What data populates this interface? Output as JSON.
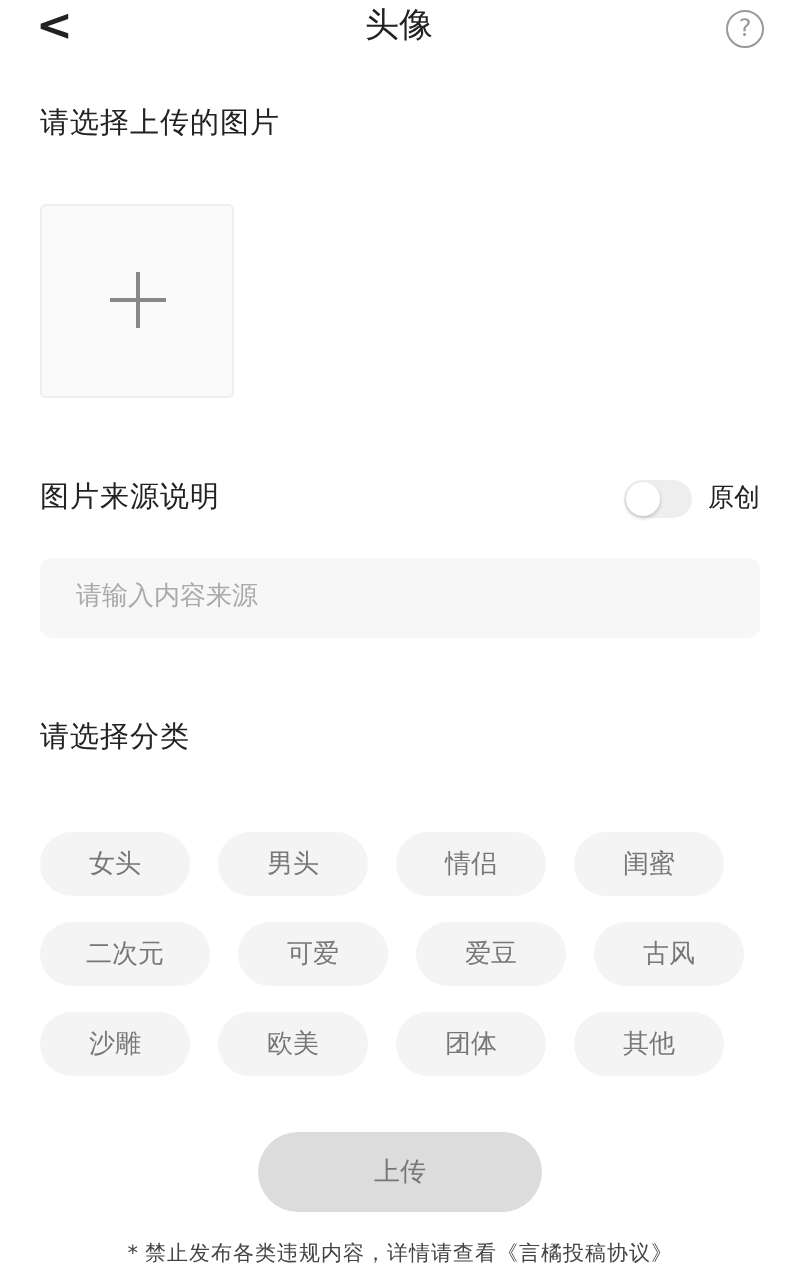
{
  "header": {
    "back": "<",
    "title": "头像",
    "help": "?"
  },
  "upload": {
    "label": "请选择上传的图片"
  },
  "source": {
    "label": "图片来源说明",
    "toggle": {
      "label": "原创",
      "on": false
    },
    "placeholder": "请输入内容来源"
  },
  "category": {
    "label": "请选择分类",
    "rows": [
      [
        {
          "label": "女头",
          "selected": false
        },
        {
          "label": "男头",
          "selected": false
        },
        {
          "label": "情侣",
          "selected": false
        },
        {
          "label": "闺蜜",
          "selected": false
        }
      ],
      [
        {
          "label": "二次元",
          "selected": false
        },
        {
          "label": "可爱",
          "selected": false
        },
        {
          "label": "爱豆",
          "selected": false
        },
        {
          "label": "古风",
          "selected": false
        }
      ],
      [
        {
          "label": "沙雕",
          "selected": false
        },
        {
          "label": "欧美",
          "selected": false
        },
        {
          "label": "团体",
          "selected": false
        },
        {
          "label": "其他",
          "selected": false
        }
      ]
    ]
  },
  "submit": {
    "label": "上传",
    "disabled": true
  },
  "notice": "* 禁止发布各类违规内容，详情请查看《言橘投稿协议》"
}
